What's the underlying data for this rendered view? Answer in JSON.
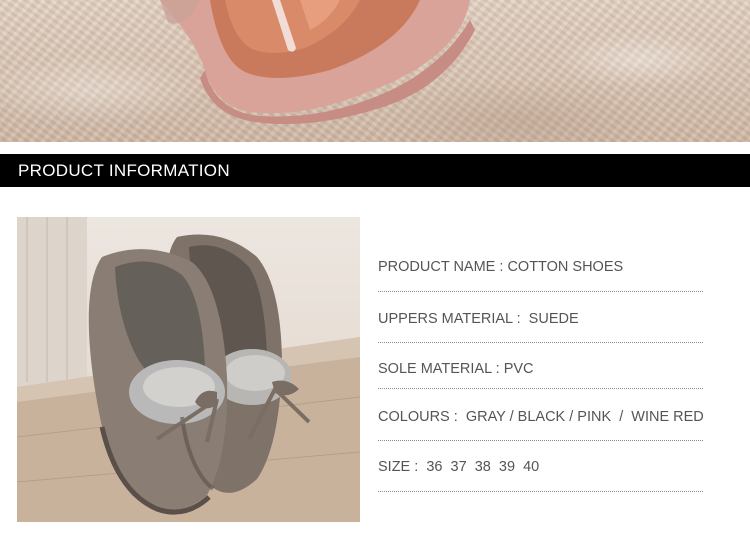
{
  "section": {
    "title": "PRODUCT INFORMATION"
  },
  "specs": [
    {
      "text": "PRODUCT NAME : COTTON SHOES"
    },
    {
      "text": "UPPERS MATERIAL :  SUEDE"
    },
    {
      "text": "SOLE MATERIAL : PVC"
    },
    {
      "text": "COLOURS :  GRAY / BLACK / PINK  /  WINE RED"
    },
    {
      "text": "SIZE :  36  37  38  39  40"
    }
  ],
  "colors": {
    "header_bg": "#000000",
    "header_text": "#ffffff",
    "spec_text": "#555555",
    "slipper_pink": "#d9a39a",
    "slipper_gray": "#8a7d73",
    "fur_gray": "#b9b9b9"
  }
}
